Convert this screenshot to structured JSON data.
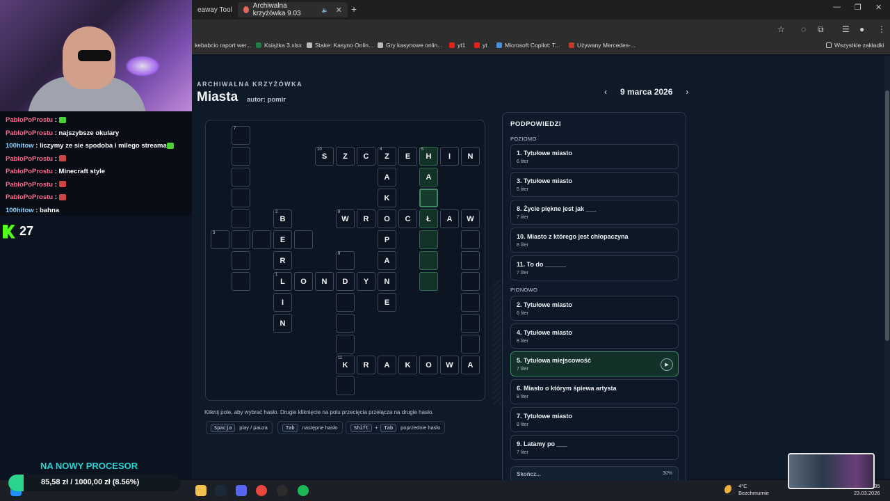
{
  "browser": {
    "tabs": [
      {
        "label": "eaway Tool",
        "active": false
      },
      {
        "label": "Archiwalna krzyżówka 9.03",
        "active": true
      }
    ],
    "bookmarks": [
      "kebabcio raport wer...",
      "Książka 3.xlsx",
      "Stake: Kasyno Onlin...",
      "Gry kasynowe onlin...",
      "yt1",
      "yt",
      "Microsoft Copilot: T...",
      "Używany Mercedes-...",
      "Wszystkie zakładki"
    ]
  },
  "header": {
    "eyebrow": "ARCHIWALNA KRZYŻÓWKA",
    "title": "Miasta",
    "author": "autor: pomir",
    "date": "9 marca 2026",
    "prev": "‹",
    "next": "›"
  },
  "grid": {
    "cells": [
      {
        "c": 1,
        "r": 0,
        "n": "7",
        "l": ""
      },
      {
        "c": 1,
        "r": 1,
        "l": ""
      },
      {
        "c": 1,
        "r": 2,
        "l": ""
      },
      {
        "c": 1,
        "r": 3,
        "l": ""
      },
      {
        "c": 1,
        "r": 4,
        "l": ""
      },
      {
        "c": 1,
        "r": 5,
        "l": ""
      },
      {
        "c": 1,
        "r": 6,
        "l": ""
      },
      {
        "c": 1,
        "r": 7,
        "l": ""
      },
      {
        "c": 5,
        "r": 1,
        "n": "10",
        "l": "S"
      },
      {
        "c": 6,
        "r": 1,
        "l": "Z"
      },
      {
        "c": 7,
        "r": 1,
        "l": "C"
      },
      {
        "c": 8,
        "r": 1,
        "n": "4",
        "l": "Z"
      },
      {
        "c": 9,
        "r": 1,
        "l": "E"
      },
      {
        "c": 10,
        "r": 1,
        "n": "5",
        "l": "H",
        "hl": true
      },
      {
        "c": 11,
        "r": 1,
        "l": "I"
      },
      {
        "c": 12,
        "r": 1,
        "l": "N"
      },
      {
        "c": 8,
        "r": 2,
        "l": "A"
      },
      {
        "c": 10,
        "r": 2,
        "l": "A",
        "hl": true
      },
      {
        "c": 8,
        "r": 3,
        "l": "K"
      },
      {
        "c": 10,
        "r": 3,
        "l": "",
        "active": true
      },
      {
        "c": 3,
        "r": 4,
        "n": "2",
        "l": "B"
      },
      {
        "c": 6,
        "r": 4,
        "n": "8",
        "l": "W"
      },
      {
        "c": 7,
        "r": 4,
        "l": "R"
      },
      {
        "c": 8,
        "r": 4,
        "l": "O"
      },
      {
        "c": 9,
        "r": 4,
        "l": "C"
      },
      {
        "c": 10,
        "r": 4,
        "l": "Ł",
        "hl": true
      },
      {
        "c": 11,
        "r": 4,
        "l": "A"
      },
      {
        "c": 12,
        "r": 4,
        "l": "W"
      },
      {
        "c": 0,
        "r": 5,
        "n": "3",
        "l": ""
      },
      {
        "c": 2,
        "r": 5,
        "l": ""
      },
      {
        "c": 3,
        "r": 5,
        "l": "E"
      },
      {
        "c": 4,
        "r": 5,
        "l": ""
      },
      {
        "c": 8,
        "r": 5,
        "l": "P"
      },
      {
        "c": 10,
        "r": 5,
        "l": "",
        "hl": true
      },
      {
        "c": 12,
        "r": 5,
        "l": ""
      },
      {
        "c": 3,
        "r": 6,
        "l": "R"
      },
      {
        "c": 6,
        "r": 6,
        "n": "9",
        "l": ""
      },
      {
        "c": 8,
        "r": 6,
        "l": "A"
      },
      {
        "c": 10,
        "r": 6,
        "l": "",
        "hl": true
      },
      {
        "c": 12,
        "r": 6,
        "l": ""
      },
      {
        "c": 3,
        "r": 7,
        "n": "1",
        "l": "L"
      },
      {
        "c": 4,
        "r": 7,
        "l": "O"
      },
      {
        "c": 5,
        "r": 7,
        "l": "N"
      },
      {
        "c": 6,
        "r": 7,
        "l": "D"
      },
      {
        "c": 7,
        "r": 7,
        "l": "Y"
      },
      {
        "c": 8,
        "r": 7,
        "l": "N"
      },
      {
        "c": 10,
        "r": 7,
        "l": "",
        "hl": true
      },
      {
        "c": 12,
        "r": 7,
        "l": ""
      },
      {
        "c": 3,
        "r": 8,
        "l": "I"
      },
      {
        "c": 6,
        "r": 8,
        "l": ""
      },
      {
        "c": 8,
        "r": 8,
        "l": "E"
      },
      {
        "c": 12,
        "r": 8,
        "l": ""
      },
      {
        "c": 3,
        "r": 9,
        "l": "N"
      },
      {
        "c": 6,
        "r": 9,
        "l": ""
      },
      {
        "c": 12,
        "r": 9,
        "l": ""
      },
      {
        "c": 6,
        "r": 10,
        "l": ""
      },
      {
        "c": 12,
        "r": 10,
        "l": ""
      },
      {
        "c": 6,
        "r": 11,
        "n": "11",
        "l": "K"
      },
      {
        "c": 7,
        "r": 11,
        "l": "R"
      },
      {
        "c": 8,
        "r": 11,
        "l": "A"
      },
      {
        "c": 9,
        "r": 11,
        "l": "K"
      },
      {
        "c": 10,
        "r": 11,
        "l": "O"
      },
      {
        "c": 11,
        "r": 11,
        "l": "W"
      },
      {
        "c": 12,
        "r": 11,
        "l": "A"
      },
      {
        "c": 6,
        "r": 12,
        "l": ""
      }
    ]
  },
  "help": {
    "text": "Kliknij pole, aby wybrać hasło. Drugie kliknięcie na polu przecięcia przełącza na drugie hasło.",
    "keys": [
      {
        "k1": "Spacja",
        "desc": "play / pauza"
      },
      {
        "k1": "Tab",
        "desc": "następne hasło"
      },
      {
        "k1": "Shift",
        "plus": "+",
        "k2": "Tab",
        "desc": "poprzednie hasło"
      }
    ]
  },
  "clues": {
    "title": "PODPOWIEDZI",
    "across_label": "POZIOMO",
    "down_label": "PIONOWO",
    "across": [
      {
        "text": "1. Tytułowe miasto",
        "meta": "6 liter"
      },
      {
        "text": "3. Tytułowe miasto",
        "meta": "5 liter"
      },
      {
        "text": "8. Życie piękne jest jak ___",
        "meta": "7 liter"
      },
      {
        "text": "10. Miasto z którego jest chłopaczyna",
        "meta": "8 liter"
      },
      {
        "text": "11. To do ______",
        "meta": "7 liter"
      }
    ],
    "down": [
      {
        "text": "2. Tytułowe miasto",
        "meta": "6 liter"
      },
      {
        "text": "4. Tytułowe miasto",
        "meta": "8 liter"
      },
      {
        "text": "5. Tytułowa miejscowość",
        "meta": "7 liter",
        "active": true
      },
      {
        "text": "6. Miasto o którym śpiewa artysta",
        "meta": "8 liter"
      },
      {
        "text": "7. Tytułowe miasto",
        "meta": "8 liter"
      },
      {
        "text": "9. Latamy po ___",
        "meta": "7 liter"
      }
    ],
    "progress_label": "Skończ...",
    "progress_pct": "30%"
  },
  "stream": {
    "chat": [
      {
        "user": "PabloPoProstu",
        "msg": " : ",
        "color": "#ff6b8a",
        "emote": "#4cd137"
      },
      {
        "user": "PabloPoProstu",
        "msg": " : najszybsze okulary",
        "color": "#ff6b8a"
      },
      {
        "user": "100hitow",
        "msg": " : liczymy ze sie spodoba i milego streama",
        "color": "#8fd3ff",
        "emote": "#4cd137"
      },
      {
        "user": "PabloPoProstu",
        "msg": " : ",
        "color": "#ff6b8a",
        "emote": "#c44"
      },
      {
        "user": "PabloPoProstu",
        "msg": " : Minecraft style",
        "color": "#ff6b8a"
      },
      {
        "user": "PabloPoProstu",
        "msg": " : ",
        "color": "#ff6b8a",
        "emote": "#c44"
      },
      {
        "user": "PabloPoProstu",
        "msg": " : ",
        "color": "#ff6b8a",
        "emote": "#c44"
      },
      {
        "user": "100hitow",
        "msg": " : bahna",
        "color": "#8fd3ff"
      }
    ],
    "viewers": "27",
    "goal_title": "NA NOWY PROCESOR",
    "goal_text": "85,58 zł / 1000,00 zł (8.56%)",
    "goal_fraction": 0.0856
  },
  "taskbar": {
    "weather_temp": "4°C",
    "weather_desc": "Bezchmurnie",
    "time": "35",
    "date": "23.03.2026"
  }
}
